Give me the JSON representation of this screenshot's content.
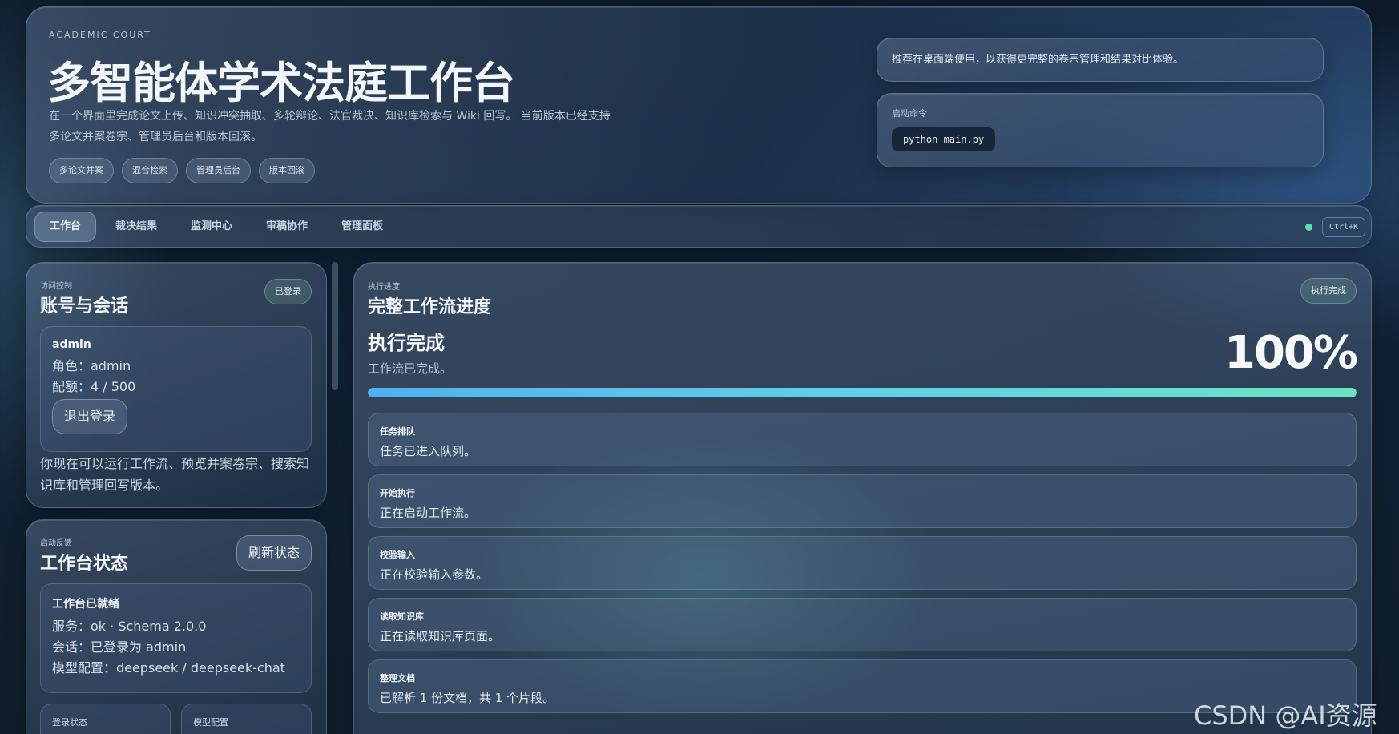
{
  "hero": {
    "eyebrow": "ACADEMIC COURT",
    "title": "多智能体学术法庭工作台",
    "desc_line1": "在一个界面里完成论文上传、知识冲突抽取、多轮辩论、法官裁决、知识库检索与 Wiki 回写。 当前版本已经支持",
    "desc_line2": "多论文并案卷宗、管理员后台和版本回滚。",
    "chips": [
      "多论文并案",
      "混合检索",
      "管理员后台",
      "版本回滚"
    ],
    "note": "推荐在桌面端使用，以获得更完整的卷宗管理和结果对比体验。",
    "cmd_label": "启动命令",
    "cmd": "python main.py"
  },
  "nav": {
    "tabs": [
      "工作台",
      "裁决结果",
      "监测中心",
      "审稿协作",
      "管理面板"
    ],
    "shortcut": "Ctrl+K",
    "status_color": "#5fe0a0"
  },
  "account": {
    "eyebrow": "访问控制",
    "title": "账号与会话",
    "badge": "已登录",
    "user": "admin",
    "role": "角色：admin",
    "quota": "配额：4 / 500",
    "logout": "退出登录",
    "hint_line1": "你现在可以运行工作流、预览并案卷宗、搜索知",
    "hint_line2": "识库和管理回写版本。"
  },
  "workbench": {
    "eyebrow": "启动反馈",
    "title": "工作台状态",
    "refresh": "刷新状态",
    "ready": "工作台已就绪",
    "service": "服务：ok · Schema 2.0.0",
    "session": "会话：已登录为 admin",
    "model": "模型配置：deepseek / deepseek-chat",
    "mini1": "登录状态",
    "mini2": "模型配置"
  },
  "progress": {
    "eyebrow": "执行进度",
    "title": "完整工作流进度",
    "badge": "执行完成",
    "status": "执行完成",
    "sub": "工作流已完成。",
    "percent_text": "100%",
    "percent": 100,
    "steps": [
      {
        "label": "任务排队",
        "text": "任务已进入队列。"
      },
      {
        "label": "开始执行",
        "text": "正在启动工作流。"
      },
      {
        "label": "校验输入",
        "text": "正在校验输入参数。"
      },
      {
        "label": "读取知识库",
        "text": "正在读取知识库页面。"
      },
      {
        "label": "整理文档",
        "text": "已解析 1 份文档，共 1 个片段。"
      }
    ]
  },
  "watermark": "CSDN @AI资源库"
}
